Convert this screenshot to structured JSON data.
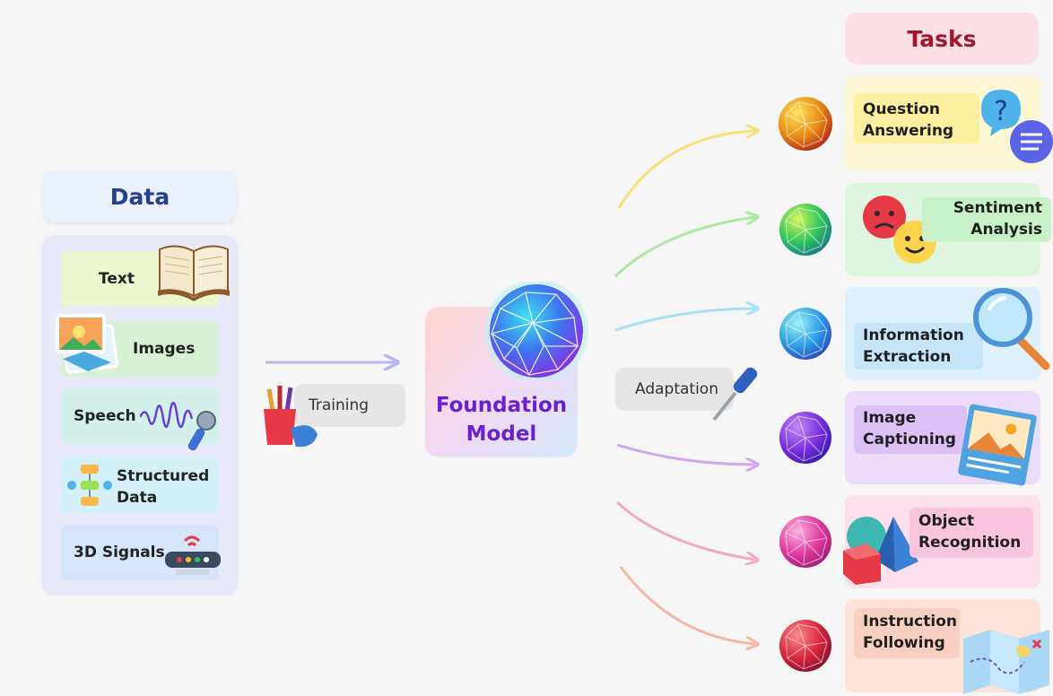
{
  "data": {
    "title": "Data",
    "items": [
      {
        "label": "Text",
        "color": "#eaf7cf"
      },
      {
        "label": "Images",
        "color": "#d9f2d5"
      },
      {
        "label": "Speech",
        "color": "#d3f1ea"
      },
      {
        "label": "Structured\nData",
        "color": "#d3f1f6"
      },
      {
        "label": "3D Signals",
        "color": "#d6e5fa"
      }
    ]
  },
  "training": {
    "label": "Training"
  },
  "model": {
    "label": "Foundation\nModel",
    "color": "#6a1fd1"
  },
  "adaptation": {
    "label": "Adaptation"
  },
  "tasks": {
    "title": "Tasks",
    "items": [
      {
        "label": "Question\nAnswering",
        "bg": "#fdf7d4",
        "chip": "#fbf09f",
        "sphere": "#e68a12"
      },
      {
        "label": "Sentiment\nAnalysis",
        "bg": "#def6df",
        "chip": "#c8f0c9",
        "sphere": "#2ec45c"
      },
      {
        "label": "Information\nExtraction",
        "bg": "#def0fb",
        "chip": "#c6e5f8",
        "sphere": "#2d9be6"
      },
      {
        "label": "Image\nCaptioning",
        "bg": "#ecdcfa",
        "chip": "#dcc1f6",
        "sphere": "#7a2ee0"
      },
      {
        "label": "Object\nRecognition",
        "bg": "#fde0ee",
        "chip": "#f9c4de",
        "sphere": "#e0389c"
      },
      {
        "label": "Instruction\nFollowing",
        "bg": "#fde3db",
        "chip": "#f9cfc1",
        "sphere": "#d8253a"
      }
    ]
  }
}
